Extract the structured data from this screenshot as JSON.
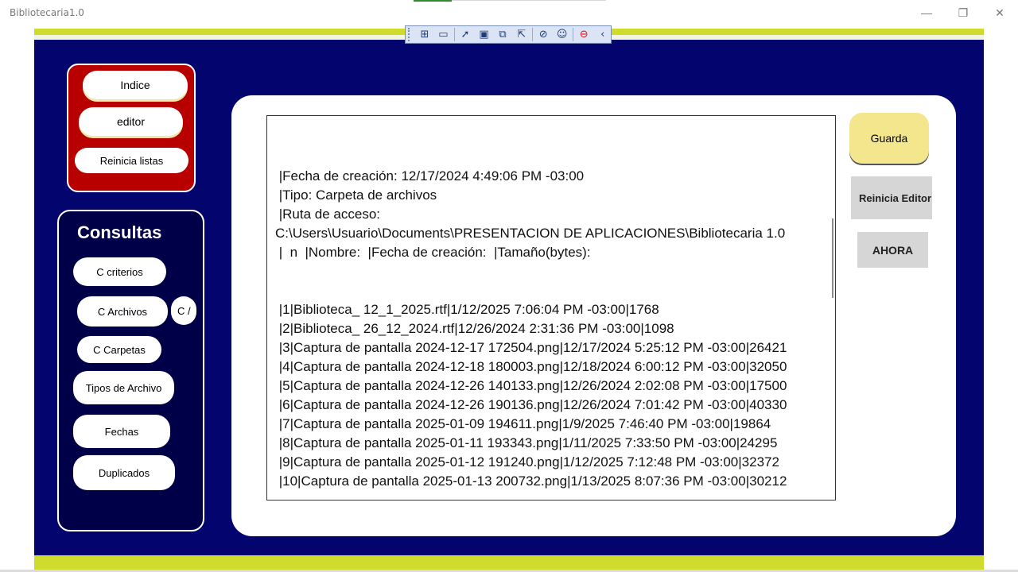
{
  "window": {
    "title": "Bibliotecaria1.0",
    "minimize_glyph": "—",
    "restore_glyph": "❐",
    "close_glyph": "✕"
  },
  "toolbar": {
    "icons": [
      "grip-icon",
      "select-element-icon",
      "video-icon",
      "pointer-select-icon",
      "frame-icon",
      "layout-adorner-icon",
      "track-focus-icon",
      "accessibility-checker-icon",
      "accessibility-icon",
      "stop-icon",
      "collapse-icon"
    ],
    "glyphs": {
      "select": "⊞",
      "video": "▭",
      "pointer": "➚",
      "frame": "▣",
      "adorner": "⧉",
      "track": "⇱",
      "checker": "⊘",
      "access": "☺",
      "stop": "⊖",
      "collapse": "‹"
    }
  },
  "nav_panel": {
    "indice": "Indice",
    "editor": "editor",
    "reinicia_listas": "Reinicia listas"
  },
  "consultas": {
    "title": "Consultas",
    "c_criterios": "C criterios",
    "c_archivos": "C Archivos",
    "c_extra": "C /",
    "c_carpetas": "C Carpetas",
    "tipos_de_archivo": "Tipos de Archivo",
    "fechas": "Fechas",
    "duplicados": "Duplicados"
  },
  "editor": {
    "lines": [
      " |Fecha de creación: 12/17/2024 4:49:06 PM -03:00",
      " |Tipo: Carpeta de archivos",
      " |Ruta de acceso:",
      "C:\\Users\\Usuario\\Documents\\PRESENTACION DE APLICACIONES\\Bibliotecaria 1.0",
      " |  n  |Nombre:  |Fecha de creación:  |Tamaño(bytes):",
      "",
      "",
      " |1|Biblioteca_ 12_1_2025.rtf|1/12/2025 7:06:04 PM -03:00|1768",
      " |2|Biblioteca_ 26_12_2024.rtf|12/26/2024 2:31:36 PM -03:00|1098",
      " |3|Captura de pantalla 2024-12-17 172504.png|12/17/2024 5:25:12 PM -03:00|26421",
      " |4|Captura de pantalla 2024-12-18 180003.png|12/18/2024 6:00:12 PM -03:00|32050",
      " |5|Captura de pantalla 2024-12-26 140133.png|12/26/2024 2:02:08 PM -03:00|17500",
      " |6|Captura de pantalla 2024-12-26 190136.png|12/26/2024 7:01:42 PM -03:00|40330",
      " |7|Captura de pantalla 2025-01-09 194611.png|1/9/2025 7:46:40 PM -03:00|19864",
      " |8|Captura de pantalla 2025-01-11 193343.png|1/11/2025 7:33:50 PM -03:00|24295",
      " |9|Captura de pantalla 2025-01-12 191240.png|1/12/2025 7:12:48 PM -03:00|32372",
      " |10|Captura de pantalla 2025-01-13 200732.png|1/13/2025 8:07:36 PM -03:00|30212"
    ]
  },
  "actions": {
    "guarda": "Guarda",
    "reinicia_editor": "Reinicia Editor",
    "ahora": "AHORA"
  },
  "colors": {
    "frame_bg": "#04046e",
    "accent_stripe": "#cfdc2e",
    "nav_panel": "#b80000",
    "consultas_panel": "#000048",
    "guarda_button": "#f4e68c"
  }
}
